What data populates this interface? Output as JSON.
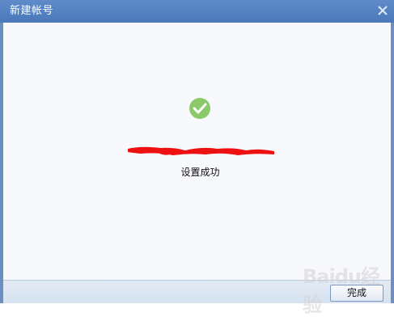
{
  "dialog": {
    "title": "新建帐号",
    "close_icon": "close-icon"
  },
  "content": {
    "success_icon": "check-circle-icon",
    "status_text": "设置成功",
    "status_color": "#8cc96b"
  },
  "footer": {
    "finish_label": "完成"
  },
  "watermark": {
    "text": "Baidu经验"
  }
}
